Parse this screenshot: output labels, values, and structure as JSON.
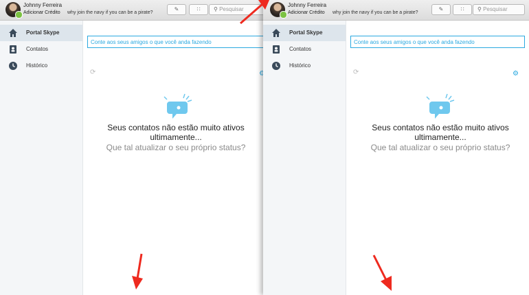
{
  "user": {
    "name": "Johnny Ferreira",
    "credit_link": "Adicionar Crédito",
    "mood_message": "why join the navy if you can be a pirate?"
  },
  "toolbar": {
    "search_placeholder": "Pesquisar"
  },
  "sidebar": {
    "items": [
      {
        "label": "Portal Skype",
        "icon": "home-icon",
        "active": true
      },
      {
        "label": "Contatos",
        "icon": "contacts-book-icon",
        "active": false
      },
      {
        "label": "Histórico",
        "icon": "clock-icon",
        "active": false
      }
    ]
  },
  "main": {
    "status_placeholder": "Conte aos seus amigos o que você anda fazendo",
    "empty_title": "Seus contatos não estão muito ativos ultimamente...",
    "empty_subtitle": "Que tal atualizar o seu próprio status?"
  },
  "colors": {
    "accent": "#29a8e0",
    "annotation_arrow": "#ee2a1f",
    "presence_online": "#7cc242"
  }
}
